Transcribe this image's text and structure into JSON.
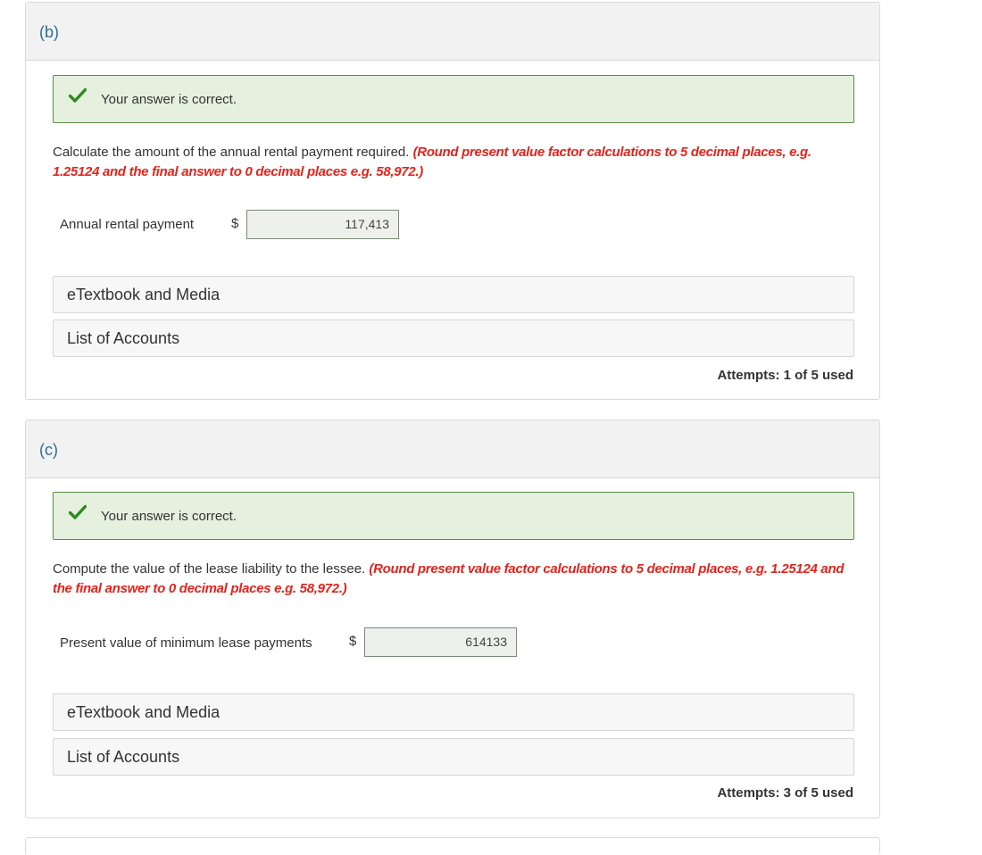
{
  "parts": {
    "b": {
      "label": "(b)",
      "feedback": "Your answer is correct.",
      "question": "Calculate the amount of the annual rental payment required.",
      "round_note": "(Round present value factor calculations to 5 decimal places, e.g. 1.25124 and the final answer to 0 decimal places e.g. 58,972.)",
      "field_label": "Annual rental payment",
      "currency": "$",
      "answer_value": "117,413",
      "resource_1": "eTextbook and Media",
      "resource_2": "List of Accounts",
      "attempts": "Attempts: 1 of 5 used"
    },
    "c": {
      "label": "(c)",
      "feedback": "Your answer is correct.",
      "question": "Compute the value of the lease liability to the lessee.",
      "round_note": "(Round present value factor calculations to 5 decimal places, e.g. 1.25124 and the final answer to 0 decimal places e.g. 58,972.)",
      "field_label": "Present value of minimum lease payments",
      "currency": "$",
      "answer_value": "614133",
      "resource_1": "eTextbook and Media",
      "resource_2": "List of Accounts",
      "attempts": "Attempts: 3 of 5 used"
    }
  },
  "colors": {
    "part_label": "#2d6e99",
    "correct_bg": "#e5f0de",
    "correct_border": "#5c8a45",
    "check": "#2f8a1e",
    "round_note": "#e0241d"
  },
  "icons": {
    "feedback_icon": "checkmark-icon"
  }
}
